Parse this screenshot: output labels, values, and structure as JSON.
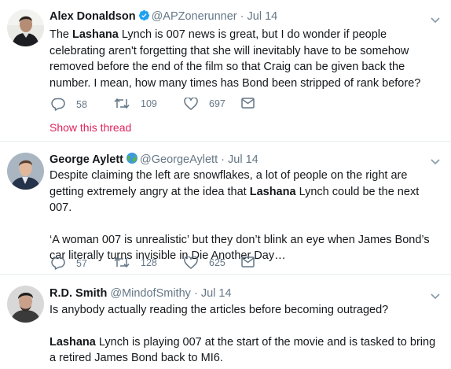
{
  "tweets": [
    {
      "name": "Alex Donaldson",
      "handle": "@APZonerunner",
      "sep": "·",
      "date": "Jul 14",
      "verified": true,
      "text": {
        "p1_a": "The ",
        "p1_kw": "Lashana",
        "p1_b": " Lynch is 007 news is great, but I do wonder if people celebrating aren't forgetting that she will inevitably have to be somehow removed before the end of the film so that Craig can be given back the number. I mean, how many times has Bond been stripped of rank before?"
      },
      "replies": "58",
      "retweets": "109",
      "likes": "697",
      "show_thread": "Show this thread"
    },
    {
      "name": "George Aylett",
      "handle": "@GeorgeAylett",
      "sep": "·",
      "date": "Jul 14",
      "badge_icon": "globe-emoji-icon",
      "text": {
        "p1_a": "Despite claiming the left are snowflakes, a lot of people on the right are getting extremely angry at the idea that ",
        "p1_kw": "Lashana",
        "p1_b": " Lynch could be the next 007.",
        "p2": "‘A woman 007 is unrealistic’ but they don’t blink an eye when James Bond’s car literally turns invisible in Die Another Day…"
      },
      "replies": "57",
      "retweets": "128",
      "likes": "625"
    },
    {
      "name": "R.D. Smith",
      "handle": "@MindofSmithy",
      "sep": "·",
      "date": "Jul 14",
      "text": {
        "p1": "Is anybody actually reading the articles before becoming outraged?",
        "p2_kw": "Lashana",
        "p2_b": " Lynch is playing 007 at the start of the movie and is tasked to bring a retired James Bond back to MI6."
      }
    }
  ],
  "colors": {
    "name": "#14171a",
    "meta": "#657786",
    "verified": "#1da1f2",
    "show_thread": "#e0245e",
    "divider": "#e6ecf0"
  },
  "icons": [
    "reply-icon",
    "retweet-icon",
    "like-icon",
    "dm-icon",
    "caret-down-icon",
    "verified-icon",
    "globe-emoji-icon"
  ]
}
